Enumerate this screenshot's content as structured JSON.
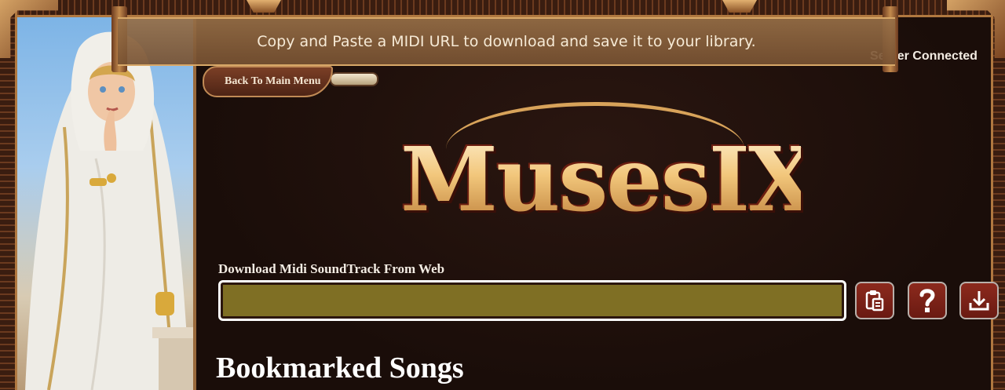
{
  "banner": {
    "message": "Copy and Paste a MIDI URL to download and save it to your library."
  },
  "status": {
    "text": "Server Connected"
  },
  "nav": {
    "back_label": "Back To Main Menu"
  },
  "logo": {
    "text": "MusesIX"
  },
  "download": {
    "label": "Download Midi SoundTrack From Web",
    "url_value": "",
    "buttons": [
      {
        "name": "paste-button",
        "icon": "clipboard-icon"
      },
      {
        "name": "help-button",
        "icon": "question-mark-icon"
      },
      {
        "name": "download-button",
        "icon": "download-icon"
      }
    ]
  },
  "bookmarks": {
    "title": "Bookmarked Songs"
  },
  "colors": {
    "background": "#1c0f0b",
    "accent_gold": "#d8a35a",
    "input_fill": "#7f6f24",
    "button_red": "#7a2218"
  }
}
